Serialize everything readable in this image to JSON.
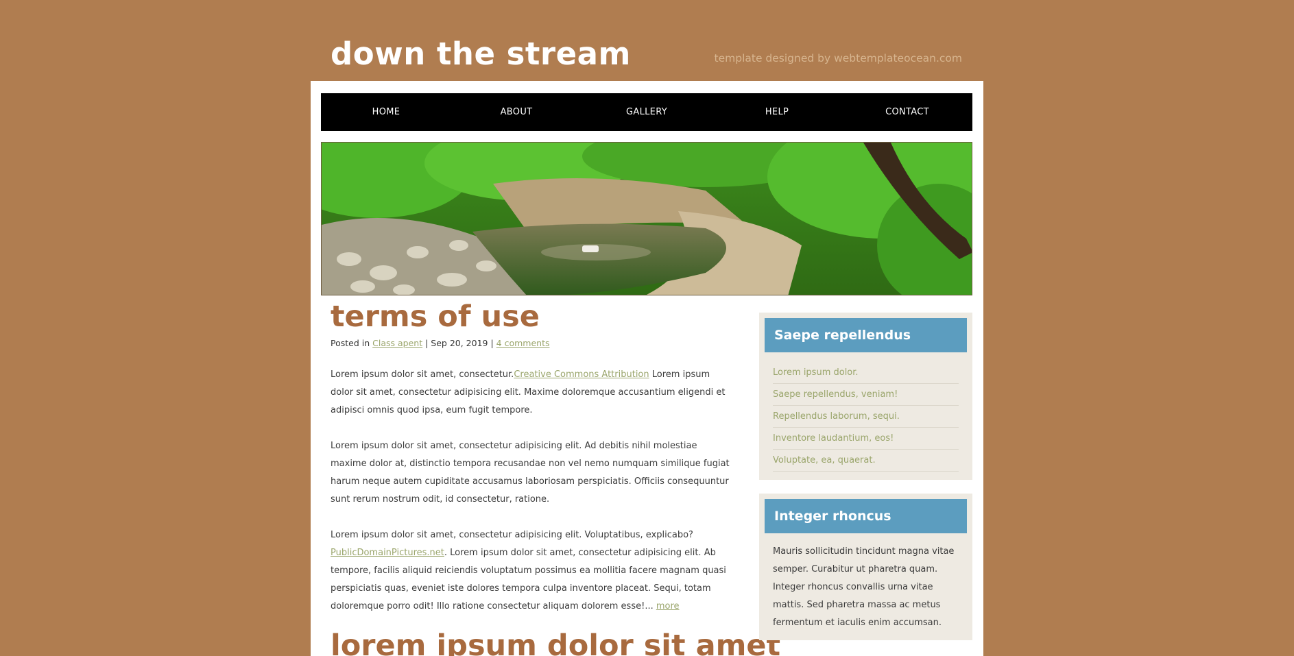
{
  "header": {
    "site_title": "down the stream",
    "credit": "template designed by webtemplateocean.com"
  },
  "nav": {
    "items": [
      "HOME",
      "ABOUT",
      "GALLERY",
      "HELP",
      "CONTACT"
    ]
  },
  "post": {
    "title": "terms of use",
    "meta": {
      "posted_in_prefix": "Posted in",
      "category": "Class apent",
      "date": "Sep 20, 2019",
      "comments": "4 comments"
    },
    "paragraphs": {
      "p1_before_link": "Lorem ipsum dolor sit amet, consectetur.",
      "p1_link": "Creative Commons Attribution",
      "p1_after_link": " Lorem ipsum dolor sit amet, consectetur adipisicing elit. Maxime doloremque accusantium eligendi et adipisci omnis quod ipsa, eum fugit tempore.",
      "p2": "Lorem ipsum dolor sit amet, consectetur adipisicing elit. Ad debitis nihil molestiae maxime dolor at, distinctio tempora recusandae non vel nemo numquam similique fugiat harum neque autem cupiditate accusamus laboriosam perspiciatis. Officiis consequuntur sunt rerum nostrum odit, id consectetur, ratione.",
      "p3_before_link": "Lorem ipsum dolor sit amet, consectetur adipisicing elit. Voluptatibus, explicabo? ",
      "p3_link": "PublicDomainPictures.net",
      "p3_after_link": ". Lorem ipsum dolor sit amet, consectetur adipisicing elit. Ab tempore, facilis aliquid reiciendis voluptatum possimus ea mollitia facere magnam quasi perspiciatis quas, eveniet iste dolores tempora culpa inventore placeat. Sequi, totam doloremque porro odit! Illo ratione consectetur aliquam dolorem esse!... ",
      "p3_more": "more"
    },
    "next_title": "lorem ipsum dolor sit amet"
  },
  "sidebar": {
    "widget1": {
      "title": "Saepe repellendus",
      "items": [
        "Lorem ipsum dolor.",
        "Saepe repellendus, veniam!",
        "Repellendus laborum, sequi.",
        "Inventore laudantium, eos!",
        "Voluptate, ea, quaerat."
      ]
    },
    "widget2": {
      "title": "Integer rhoncus",
      "text": "Mauris sollicitudin tincidunt magna vitae semper. Curabitur ut pharetra quam. Integer rhoncus convallis urna vitae mattis. Sed pharetra massa ac metus fermentum et iaculis enim accumsan."
    }
  },
  "colors": {
    "background": "#b07d50",
    "nav_bg": "#000000",
    "title_brown": "#a86a3e",
    "link_green": "#9aa56b",
    "widget_blue": "#5c9dbf",
    "widget_bg": "#eeeae2"
  }
}
